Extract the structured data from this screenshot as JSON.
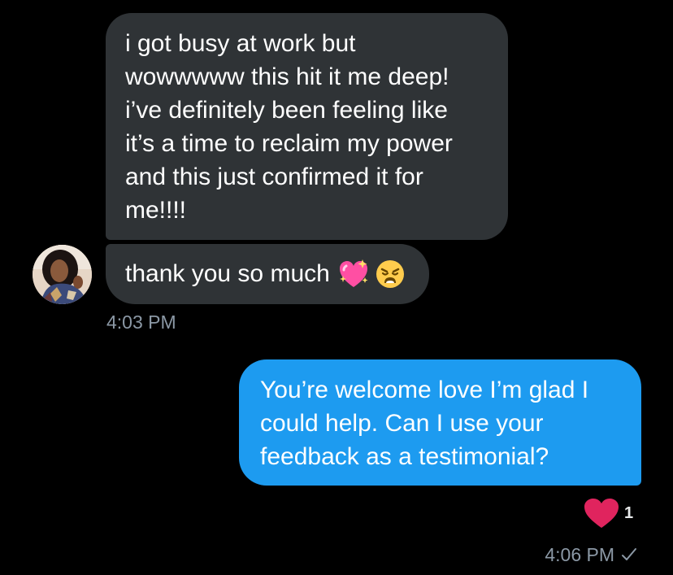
{
  "conversation": {
    "received_messages": [
      {
        "text": "i got busy at work but\nwowwwww this hit it me deep!\ni’ve definitely been feeling like\nit’s a time to reclaim my power\nand this just confirmed it for\nme!!!!"
      },
      {
        "text": "thank you so much",
        "emoji": [
          "sparkling-heart",
          "weary-face"
        ]
      }
    ],
    "received_time": "4:03 PM",
    "sent_message": {
      "text": "You’re welcome love I’m glad I\ncould help. Can I use your\nfeedback as a testimonial?"
    },
    "reaction": {
      "icon": "heart",
      "count": "1"
    },
    "sent_time": "4:06 PM",
    "sent_status_icon": "check-icon"
  },
  "colors": {
    "background": "#000000",
    "received_bubble": "#2f3336",
    "sent_bubble": "#1d9bf0",
    "timestamp": "#8b98a5",
    "heart": "#e0245e"
  }
}
